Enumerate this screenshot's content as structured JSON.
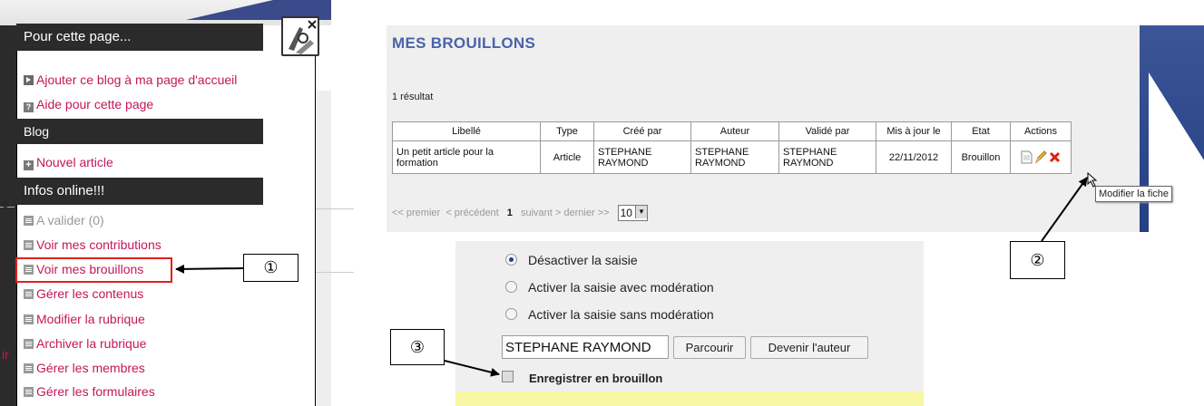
{
  "left_menu": {
    "title": "Pour cette page...",
    "items_top": [
      "Ajouter ce blog à ma page d'accueil",
      "Aide pour cette page"
    ],
    "blog_header": "Blog",
    "blog_items": [
      "Nouvel article"
    ],
    "infos_header": "Infos online!!!",
    "infos_items": [
      "A valider (0)",
      "Voir mes contributions",
      "Voir mes brouillons",
      "Gérer les contenus",
      "Modifier la rubrique",
      "Archiver la rubrique",
      "Gérer les membres",
      "Gérer les formulaires"
    ],
    "edge_text_1": "e",
    "edge_text_2": "ir"
  },
  "callouts": {
    "one": "①",
    "two": "②",
    "three": "③"
  },
  "drafts": {
    "title": "MES BROUILLONS",
    "result_count": "1 résultat",
    "columns": [
      "Libellé",
      "Type",
      "Créé par",
      "Auteur",
      "Validé par",
      "Mis à jour le",
      "Etat",
      "Actions"
    ],
    "row": {
      "libelle": "Un petit article pour la formation",
      "type": "Article",
      "cree_par": "STEPHANE RAYMOND",
      "auteur": "STEPHANE RAYMOND",
      "valide_par": "STEPHANE RAYMOND",
      "mis_a_jour": "22/11/2012",
      "etat": "Brouillon"
    },
    "tooltip": "Modifier la fiche",
    "pager": {
      "first": "<< premier",
      "prev": "< précédent",
      "current": "1",
      "next": "suivant >",
      "last": "dernier >>",
      "page_size": "10"
    }
  },
  "form": {
    "radio_options": [
      "Désactiver la saisie",
      "Activer la saisie avec modération",
      "Activer la saisie sans modération"
    ],
    "selected_radio": 0,
    "author_value": "STEPHANE RAYMOND",
    "browse_label": "Parcourir",
    "become_author_label": "Devenir l'auteur",
    "save_draft_label": "Enregistrer en brouillon"
  },
  "colors": {
    "link": "#c4165a",
    "title_blue": "#4a63a8",
    "highlight_red": "#e0201c",
    "panel_dark": "#2b2b2b"
  }
}
